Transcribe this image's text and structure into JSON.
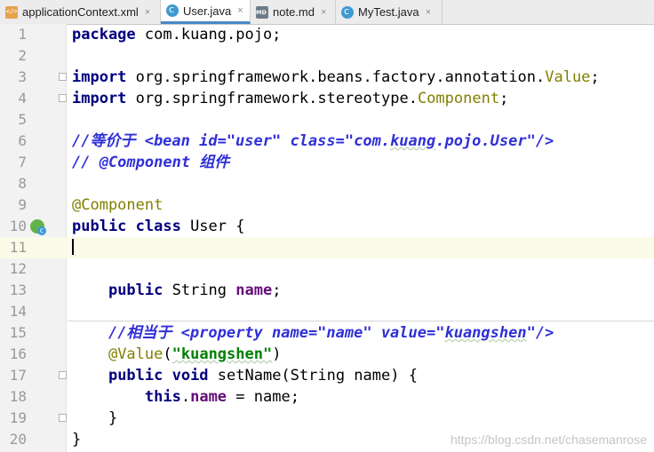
{
  "tabs": [
    {
      "label": "applicationContext.xml",
      "icon": "xml-file-icon",
      "active": false
    },
    {
      "label": "User.java",
      "icon": "java-class-icon",
      "active": true
    },
    {
      "label": "note.md",
      "icon": "markdown-file-icon",
      "active": false
    },
    {
      "label": "MyTest.java",
      "icon": "java-class-icon",
      "active": false
    }
  ],
  "tab_close_glyph": "×",
  "lines": [
    {
      "n": "1"
    },
    {
      "n": "2"
    },
    {
      "n": "3"
    },
    {
      "n": "4"
    },
    {
      "n": "5"
    },
    {
      "n": "6"
    },
    {
      "n": "7"
    },
    {
      "n": "8"
    },
    {
      "n": "9"
    },
    {
      "n": "10"
    },
    {
      "n": "11"
    },
    {
      "n": "12"
    },
    {
      "n": "13"
    },
    {
      "n": "14"
    },
    {
      "n": "15"
    },
    {
      "n": "16"
    },
    {
      "n": "17"
    },
    {
      "n": "18"
    },
    {
      "n": "19"
    },
    {
      "n": "20"
    }
  ],
  "code": {
    "l1_kw": "package",
    "l1_rest": " com.kuang.pojo;",
    "l3_kw": "import",
    "l3_rest": " org.springframework.beans.factory.annotation.",
    "l3_ann": "Value",
    "l3_end": ";",
    "l4_kw": "import",
    "l4_rest": " org.springframework.stereotype.",
    "l4_ann": "Component",
    "l4_end": ";",
    "l6_a": "//等价于 <bean id=\"user\" class=\"com.",
    "l6_b": "kuang",
    "l6_c": ".pojo.User\"/>",
    "l7": "// @Component 组件",
    "l9": "@Component",
    "l10_kw": "public class",
    "l10_rest": " User {",
    "l13_kw": "public",
    "l13_rest": " String ",
    "l13_fld": "name",
    "l13_end": ";",
    "l15_a": "//相当于 <property name=\"name\" value=\"",
    "l15_b": "kuangshen",
    "l15_c": "\"/>",
    "l16_ann": "@Value",
    "l16_p": "(",
    "l16_str": "\"kuangshen\"",
    "l16_end": ")",
    "l17_kw": "public void",
    "l17_rest": " setName(String name) {",
    "l18_kw": "this",
    "l18_dot": ".",
    "l18_fld": "name",
    "l18_rest": " = name;",
    "l19": "}",
    "l20": "}"
  },
  "watermark": "https://blog.csdn.net/chasemanrose",
  "colors": {
    "keyword": "#000080",
    "annotation": "#808000",
    "comment": "#2f2fd8",
    "string": "#008000",
    "field": "#660e7a",
    "active_tab_underline": "#4a88c7",
    "current_line": "#fcfae8"
  }
}
